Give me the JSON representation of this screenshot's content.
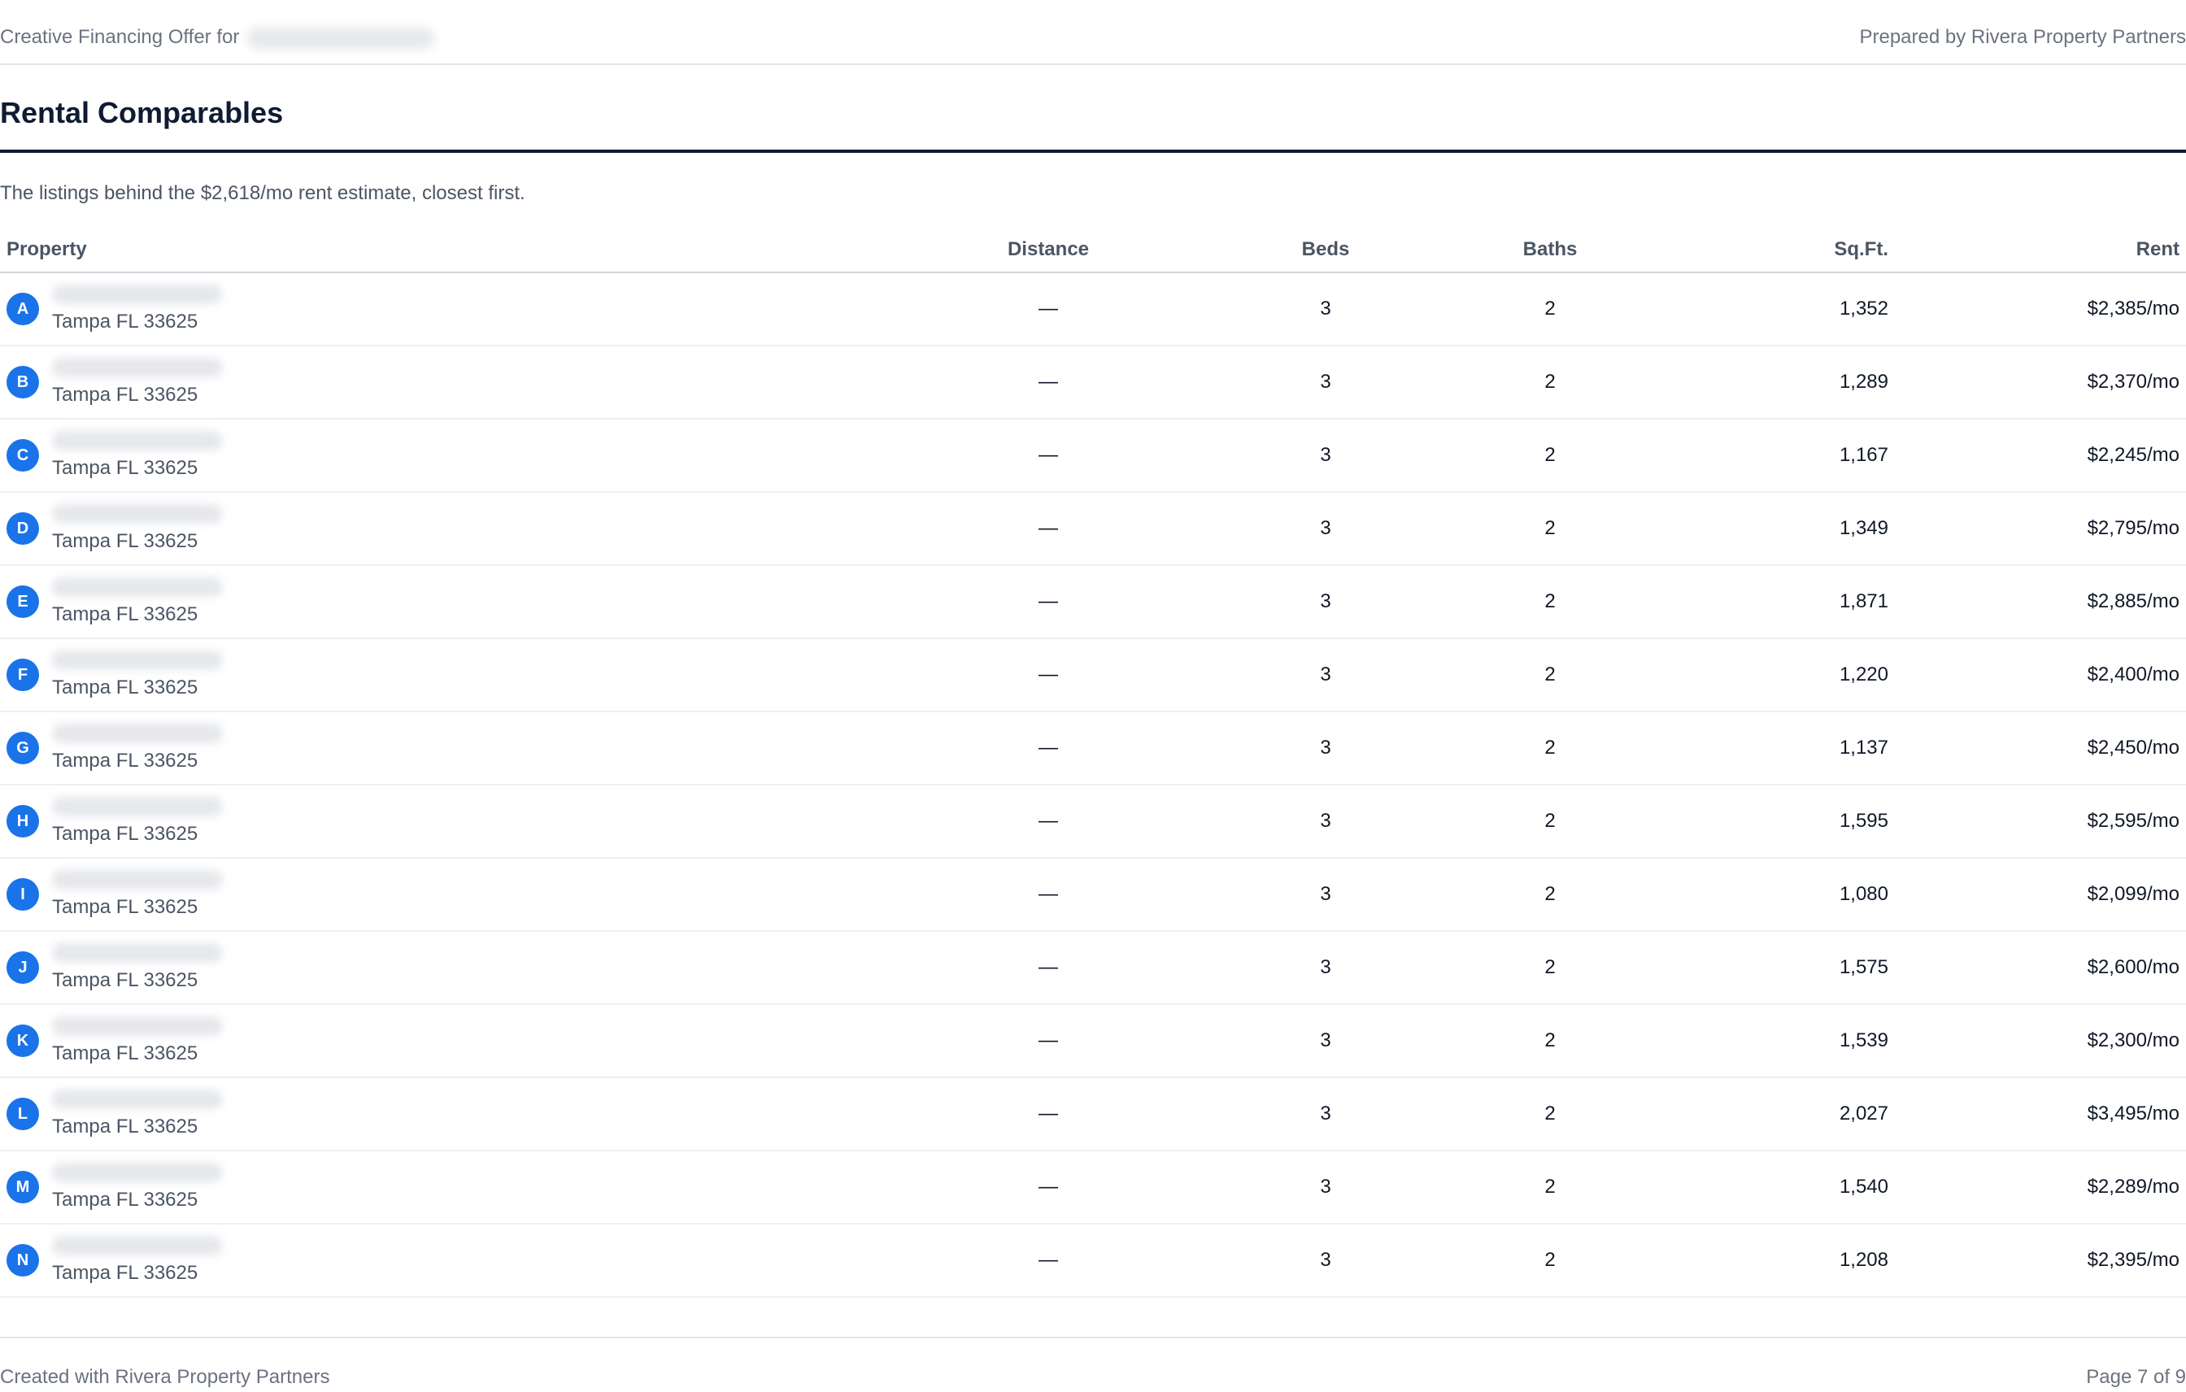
{
  "header": {
    "offer_label": "Creative Financing Offer for",
    "prepared_by": "Prepared by Rivera Property Partners"
  },
  "section": {
    "title": "Rental Comparables",
    "subtitle": "The listings behind the $2,618/mo rent estimate, closest first."
  },
  "table": {
    "columns": {
      "property": "Property",
      "distance": "Distance",
      "beds": "Beds",
      "baths": "Baths",
      "sqft": "Sq.Ft.",
      "rent": "Rent"
    },
    "marker_color": "#1a73e8",
    "rows": [
      {
        "marker": "A",
        "city": "Tampa FL 33625",
        "distance": "—",
        "beds": "3",
        "baths": "2",
        "sqft": "1,352",
        "rent": "$2,385/mo"
      },
      {
        "marker": "B",
        "city": "Tampa FL 33625",
        "distance": "—",
        "beds": "3",
        "baths": "2",
        "sqft": "1,289",
        "rent": "$2,370/mo"
      },
      {
        "marker": "C",
        "city": "Tampa FL 33625",
        "distance": "—",
        "beds": "3",
        "baths": "2",
        "sqft": "1,167",
        "rent": "$2,245/mo"
      },
      {
        "marker": "D",
        "city": "Tampa FL 33625",
        "distance": "—",
        "beds": "3",
        "baths": "2",
        "sqft": "1,349",
        "rent": "$2,795/mo"
      },
      {
        "marker": "E",
        "city": "Tampa FL 33625",
        "distance": "—",
        "beds": "3",
        "baths": "2",
        "sqft": "1,871",
        "rent": "$2,885/mo"
      },
      {
        "marker": "F",
        "city": "Tampa FL 33625",
        "distance": "—",
        "beds": "3",
        "baths": "2",
        "sqft": "1,220",
        "rent": "$2,400/mo"
      },
      {
        "marker": "G",
        "city": "Tampa FL 33625",
        "distance": "—",
        "beds": "3",
        "baths": "2",
        "sqft": "1,137",
        "rent": "$2,450/mo"
      },
      {
        "marker": "H",
        "city": "Tampa FL 33625",
        "distance": "—",
        "beds": "3",
        "baths": "2",
        "sqft": "1,595",
        "rent": "$2,595/mo"
      },
      {
        "marker": "I",
        "city": "Tampa FL 33625",
        "distance": "—",
        "beds": "3",
        "baths": "2",
        "sqft": "1,080",
        "rent": "$2,099/mo"
      },
      {
        "marker": "J",
        "city": "Tampa FL 33625",
        "distance": "—",
        "beds": "3",
        "baths": "2",
        "sqft": "1,575",
        "rent": "$2,600/mo"
      },
      {
        "marker": "K",
        "city": "Tampa FL 33625",
        "distance": "—",
        "beds": "3",
        "baths": "2",
        "sqft": "1,539",
        "rent": "$2,300/mo"
      },
      {
        "marker": "L",
        "city": "Tampa FL 33625",
        "distance": "—",
        "beds": "3",
        "baths": "2",
        "sqft": "2,027",
        "rent": "$3,495/mo"
      },
      {
        "marker": "M",
        "city": "Tampa FL 33625",
        "distance": "—",
        "beds": "3",
        "baths": "2",
        "sqft": "1,540",
        "rent": "$2,289/mo"
      },
      {
        "marker": "N",
        "city": "Tampa FL 33625",
        "distance": "—",
        "beds": "3",
        "baths": "2",
        "sqft": "1,208",
        "rent": "$2,395/mo"
      }
    ]
  },
  "footer": {
    "created_with": "Created with Rivera Property Partners",
    "page": "Page 7 of 9"
  }
}
